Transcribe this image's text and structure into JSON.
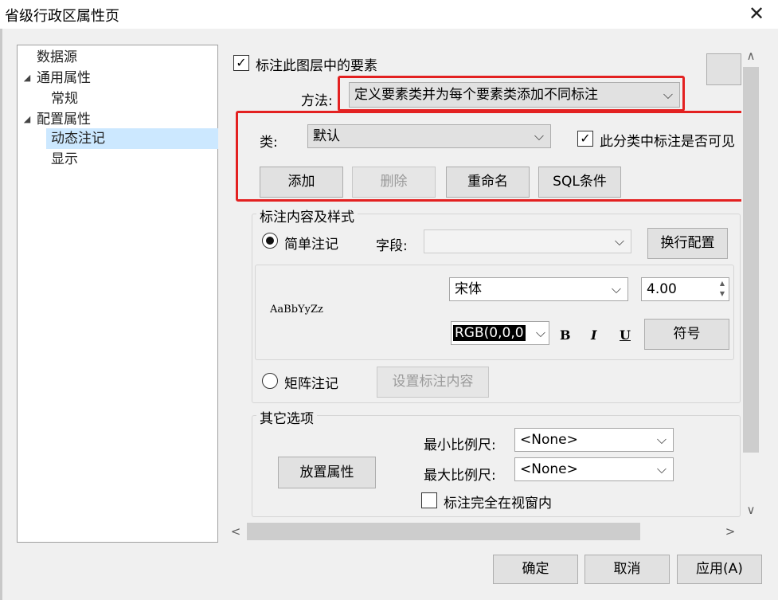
{
  "window": {
    "title": "省级行政区属性页",
    "close_label": "✕"
  },
  "tree": {
    "items": [
      {
        "label": "数据源",
        "toggle": ""
      },
      {
        "label": "通用属性",
        "toggle": "◢"
      },
      {
        "label": "常规",
        "toggle": ""
      },
      {
        "label": "配置属性",
        "toggle": "◢"
      },
      {
        "label": "动态注记",
        "toggle": ""
      },
      {
        "label": "显示",
        "toggle": ""
      }
    ],
    "selected": "动态注记"
  },
  "label_layer": {
    "checkbox_label": "标注此图层中的要素",
    "checked": true,
    "check_glyph": "✓"
  },
  "method": {
    "label": "方法:",
    "value": "定义要素类并为每个要素类添加不同标注"
  },
  "class_section": {
    "label": "类:",
    "value": "默认",
    "visible_label": "此分类中标注是否可见",
    "visible_checked": true,
    "buttons": {
      "add": "添加",
      "delete": "删除",
      "rename": "重命名",
      "sql": "SQL条件"
    }
  },
  "content_style": {
    "group_title": "标注内容及样式",
    "simple_label": "简单注记",
    "field_label": "字段:",
    "field_value": "",
    "wrap_button": "换行配置",
    "preview_text": "AaBbYyZz",
    "font_value": "宋体",
    "size_value": "4.00",
    "color_value": "RGB(0,0,0",
    "bold": "B",
    "italic": "I",
    "underline": "U",
    "symbol_button": "符号",
    "matrix_label": "矩阵注记",
    "set_content_button": "设置标注内容"
  },
  "other_options": {
    "group_title": "其它选项",
    "placement_button": "放置属性",
    "min_scale_label": "最小比例尺:",
    "min_scale_value": "<None>",
    "max_scale_label": "最大比例尺:",
    "max_scale_value": "<None>",
    "fully_in_view_label": "标注完全在视窗内",
    "fully_in_view_checked": false
  },
  "footer": {
    "ok": "确定",
    "cancel": "取消",
    "apply": "应用(A)"
  },
  "icons": {
    "chevron_down": "⌵",
    "arrow_up": "∧",
    "arrow_down": "∨",
    "arrow_left": "<",
    "arrow_right": ">",
    "spin_up": "▲",
    "spin_down": "▼"
  }
}
